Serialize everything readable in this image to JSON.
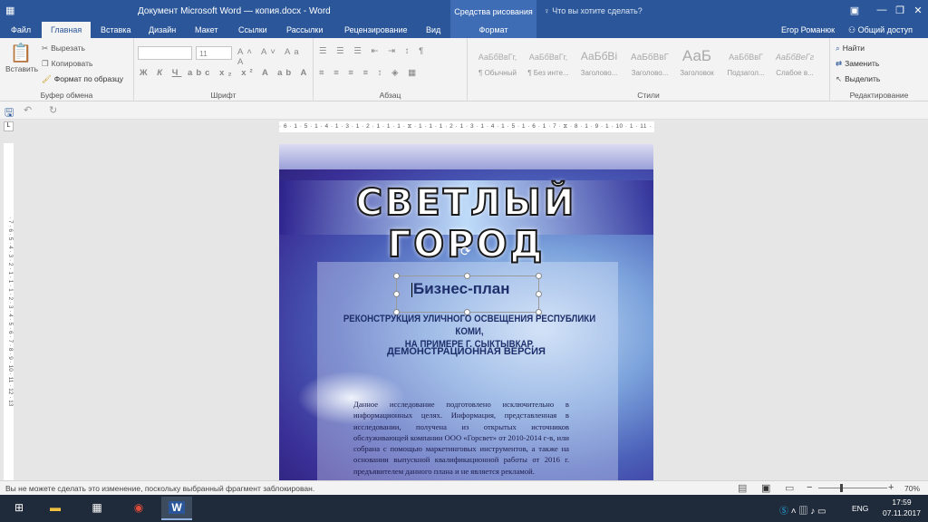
{
  "window": {
    "title": "Документ Microsoft Word — копия.docx - Word",
    "context_tools": "Средства рисования",
    "tell_me": "Что вы хотите сделать?",
    "user": "Егор Романюк",
    "share": "Общий доступ"
  },
  "tabs": [
    "Файл",
    "Главная",
    "Вставка",
    "Дизайн",
    "Макет",
    "Ссылки",
    "Рассылки",
    "Рецензирование",
    "Вид"
  ],
  "context_tab": "Формат",
  "ribbon": {
    "clipboard": {
      "paste": "Вставить",
      "cut": "Вырезать",
      "copy": "Копировать",
      "format_painter": "Формат по образцу",
      "label": "Буфер обмена"
    },
    "font": {
      "size": "11",
      "label": "Шрифт",
      "bold": "Ж",
      "italic": "К",
      "underline": "Ч"
    },
    "paragraph": {
      "label": "Абзац"
    },
    "styles": {
      "label": "Стили",
      "items": [
        {
          "preview": "АаБбВвГг,",
          "name": "¶ Обычный"
        },
        {
          "preview": "АаБбВвГг,",
          "name": "¶ Без инте..."
        },
        {
          "preview": "АаБбВі",
          "name": "Заголово..."
        },
        {
          "preview": "АаБбВвГ",
          "name": "Заголово..."
        },
        {
          "preview": "АаБ",
          "name": "Заголовок"
        },
        {
          "preview": "АаБбВвГ",
          "name": "Подзагол..."
        },
        {
          "preview": "АаБбВеГг",
          "name": "Слабое в..."
        }
      ]
    },
    "editing": {
      "find": "Найти",
      "replace": "Заменить",
      "select": "Выделить",
      "label": "Редактирование"
    }
  },
  "ruler": {
    "horizontal": "· 6 · 1 · 5 · 1 · 4 · 1 · 3 · 1 · 2 · 1 · 1 · 1 · ⧖ · 1 · 1 · 1 · 2 · 1 · 3 · 1 · 4 · 1 · 5 · 1 · 6 · 1 · 7 · ⧖ · 8 · 1 · 9 · 1 · 10 · 1 · 11 · 1 · 12 · 1 · 13 · 1 · 14",
    "vertical": "· 7 · 6 · 5 · 4 · 3 · 2 · 1 · 1 · 1 · 2 · 3 · 4 · 5 · 6 · 7 · 8 · 9 · 10 · 11 · 12 · 13",
    "corner": "L"
  },
  "document": {
    "title": "СВЕТЛЫЙ ГОРОД",
    "subtitle": "Бизнес-план",
    "heading_line1": "РЕКОНСТРУКЦИЯ УЛИЧНОГО ОСВЕЩЕНИЯ РЕСПУБЛИКИ КОМИ,",
    "heading_line2": "НА ПРИМЕРЕ Г. СЫКТЫВКАР.",
    "version": "ДЕМОНСТРАЦИОННАЯ ВЕРСИЯ",
    "body": "Данное исследование подготовлено исключительно в информационных целях. Информация, представленная в исследовании, получена из открытых источников обслуживающей компании ООО «Горсвет» от 2010-2014 г-в, или собрана с помощью маркетинговых инструментов, а также на основании выпускной квалификационной работы от 2016 г. предъявителем данного плана и не является рекламой."
  },
  "status": {
    "message": "Вы не можете сделать это изменение, поскольку выбранный фрагмент заблокирован.",
    "zoom": "70%"
  },
  "taskbar": {
    "lang": "ENG",
    "time": "17:59",
    "date": "07.11.2017"
  },
  "colors": {
    "word_blue": "#2b579a",
    "context_blue": "#3e6db5"
  }
}
